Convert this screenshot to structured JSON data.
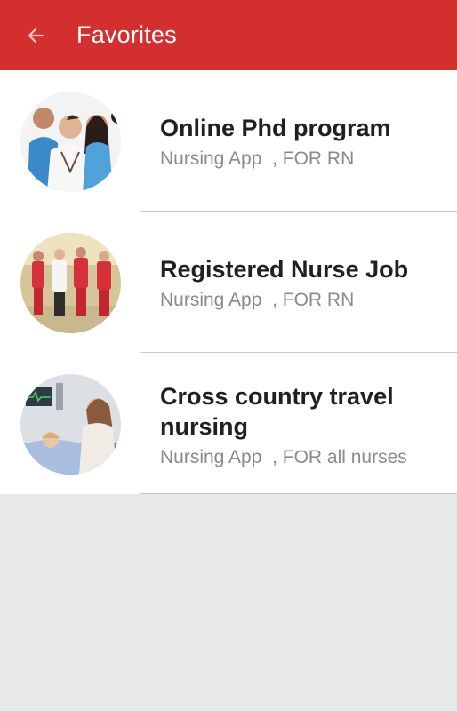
{
  "app_bar": {
    "title": "Favorites",
    "back_icon": "arrow-left-icon",
    "color": "#d32f2f"
  },
  "favorites": [
    {
      "title": "Online Phd program",
      "subtitle": "Nursing App  , FOR RN"
    },
    {
      "title": "Registered Nurse Job",
      "subtitle": "Nursing App  , FOR RN"
    },
    {
      "title": "Cross country travel nursing",
      "subtitle": "Nursing App  , FOR all nurses"
    }
  ]
}
